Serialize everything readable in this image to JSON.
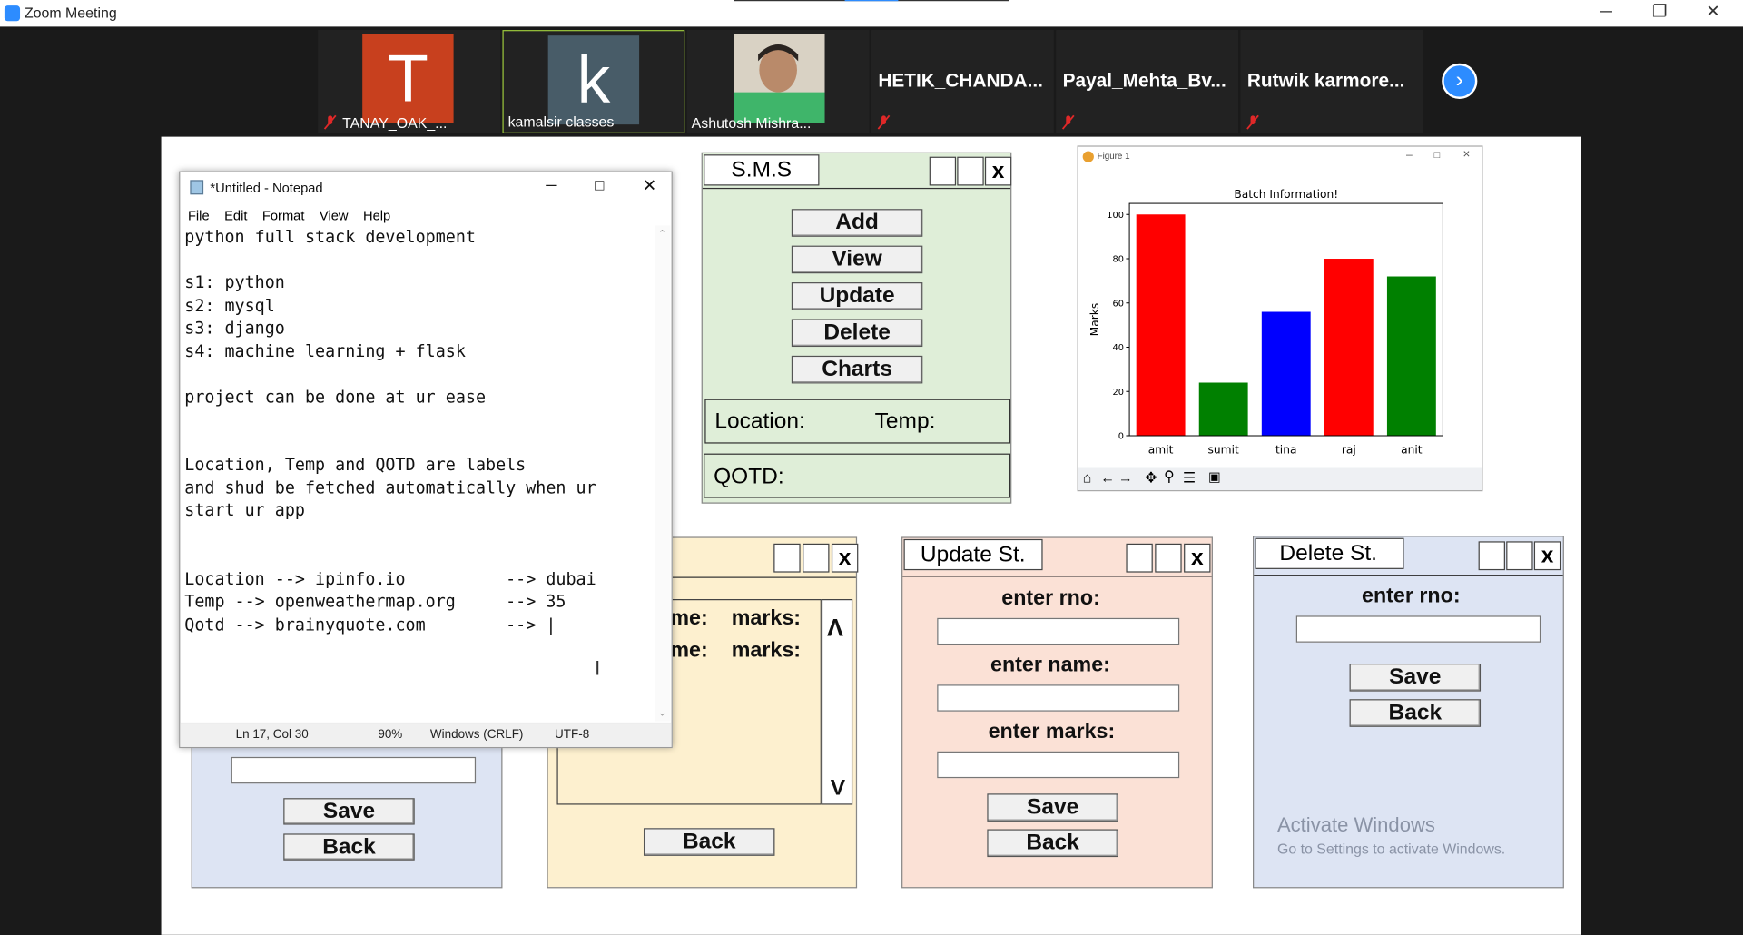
{
  "window": {
    "title": "Zoom Meeting",
    "min": "─",
    "max": "❐",
    "close": "✕"
  },
  "participants": [
    {
      "name": "TANAY_OAK_...",
      "initial": "T",
      "color": "#c8401e"
    },
    {
      "name": "kamalsir classes",
      "initial": "k",
      "color": "#485c68"
    },
    {
      "name": "Ashutosh Mishra..."
    },
    {
      "name": "HETIK_CHANDA..."
    },
    {
      "name": "Payal_Mehta_Bv..."
    },
    {
      "name": "Rutwik  karmore..."
    }
  ],
  "next_icon": "›",
  "notepad": {
    "title": "*Untitled - Notepad",
    "menu": [
      "File",
      "Edit",
      "Format",
      "View",
      "Help"
    ],
    "content": "python full stack development\n\ns1: python\ns2: mysql\ns3: django\ns4: machine learning + flask\n\nproject can be done at ur ease\n\n\nLocation, Temp and QOTD are labels\nand shud be fetched automatically when ur\nstart ur app\n\n\nLocation --> ipinfo.io          --> dubai\nTemp --> openweathermap.org     --> 35\nQotd --> brainyquote.com        --> |",
    "status": {
      "pos": "Ln 17, Col 30",
      "zoom": "90%",
      "eol": "Windows (CRLF)",
      "enc": "UTF-8"
    }
  },
  "sms": {
    "title": "S.M.S",
    "close": "x",
    "buttons": [
      "Add",
      "View",
      "Update",
      "Delete",
      "Charts"
    ],
    "location_label": "Location:",
    "temp_label": "Temp:",
    "qotd_label": "QOTD:"
  },
  "view_win": {
    "close": "x",
    "row1_name": "me:",
    "row1_marks": "marks:",
    "row2_name": "me:",
    "row2_marks": "marks:",
    "scroll_up": "Λ",
    "scroll_down": "V",
    "back": "Back"
  },
  "add_win": {
    "save": "Save",
    "back": "Back"
  },
  "update_win": {
    "title": "Update St.",
    "close": "x",
    "rno": "enter rno:",
    "name": "enter name:",
    "marks": "enter marks:",
    "save": "Save",
    "back": "Back"
  },
  "delete_win": {
    "title": "Delete St.",
    "close": "x",
    "rno": "enter rno:",
    "save": "Save",
    "back": "Back",
    "watermark1": "Activate Windows",
    "watermark2": "Go to Settings to activate Windows."
  },
  "figure": {
    "title": "Figure 1"
  },
  "chart_data": {
    "type": "bar",
    "title": "Batch Information!",
    "ylabel": "Marks",
    "xlabel": "",
    "categories": [
      "amit",
      "sumit",
      "tina",
      "raj",
      "anit"
    ],
    "values": [
      100,
      24,
      56,
      80,
      72
    ],
    "colors": [
      "#ff0000",
      "#008000",
      "#0000ff",
      "#ff0000",
      "#008000"
    ],
    "ylim": [
      0,
      105
    ],
    "yticks": [
      0,
      20,
      40,
      60,
      80,
      100
    ]
  }
}
